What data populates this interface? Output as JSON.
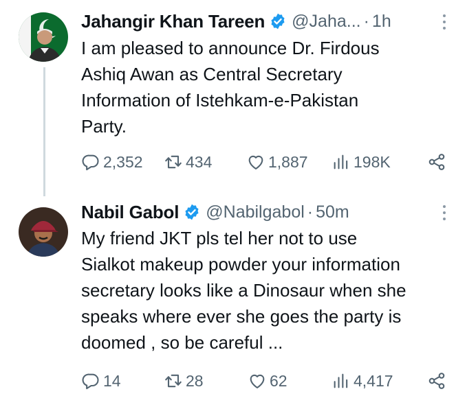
{
  "tweets": [
    {
      "author": {
        "name": "Jahangir Khan Tareen",
        "handle": "@Jaha...",
        "time": "1h",
        "avatar_icon": "avatar-flag-portrait"
      },
      "text": "I am pleased to announce Dr. Firdous\nAshiq Awan as Central Secretary\nInformation of Istehkam-e-Pakistan\nParty.",
      "stats": {
        "replies": "2,352",
        "retweets": "434",
        "likes": "1,887",
        "views": "198K"
      }
    },
    {
      "author": {
        "name": "Nabil Gabol",
        "handle": "@Nabilgabol",
        "time": "50m",
        "avatar_icon": "avatar-portrait-cap"
      },
      "text": "My friend JKT pls tel her not to use\nSialkot makeup powder your information\nsecretary looks like a Dinosaur when she\nspeaks where ever she goes the party is\ndoomed , so be careful ...",
      "stats": {
        "replies": "14",
        "retweets": "28",
        "likes": "62",
        "views": "4,417"
      }
    }
  ],
  "separator": "·",
  "colors": {
    "text": "#0f1419",
    "secondary": "#536471",
    "verified": "#1d9bf0",
    "thread_line": "#cfd9de"
  }
}
